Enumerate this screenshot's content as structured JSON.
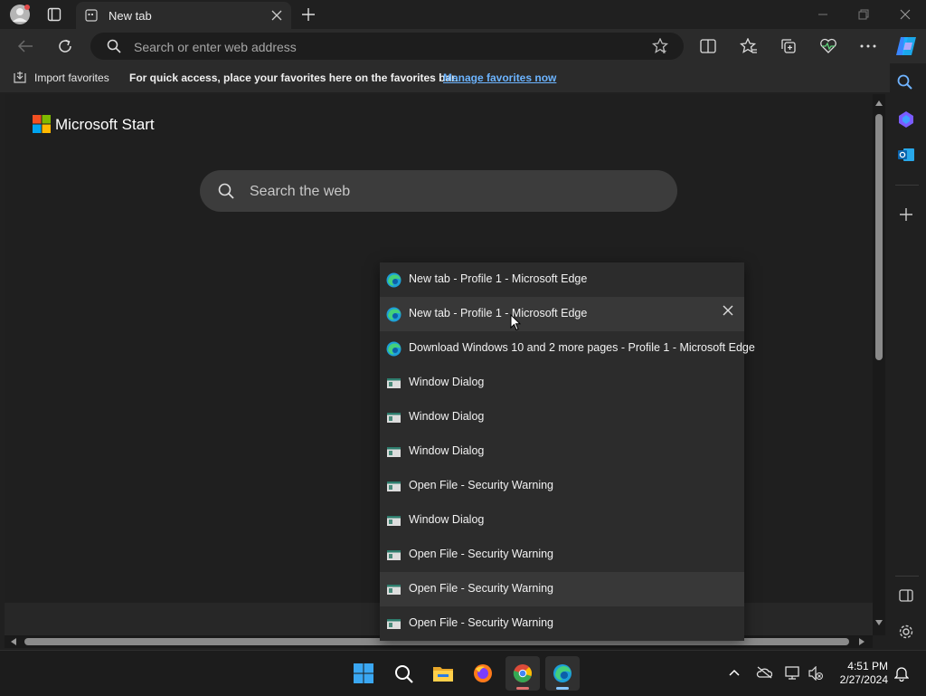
{
  "browser": {
    "tab_title": "New tab",
    "address_placeholder": "Search or enter web address"
  },
  "favorites_bar": {
    "import_label": "Import favorites",
    "hint": "For quick access, place your favorites here on the favorites bar.",
    "manage_link": "Manage favorites now"
  },
  "page": {
    "logo_text": "Microsoft Start",
    "search_placeholder": "Search the web"
  },
  "switcher": {
    "items": [
      {
        "label": "New tab - Profile 1 - Microsoft Edge",
        "icon": "edge-icon"
      },
      {
        "label": "New tab - Profile 1 - Microsoft Edge",
        "icon": "edge-icon"
      },
      {
        "label": "Download Windows 10 and 2 more pages - Profile 1 - Microsoft Edge",
        "icon": "edge-icon"
      },
      {
        "label": "Window Dialog",
        "icon": "window-icon"
      },
      {
        "label": "Window Dialog",
        "icon": "window-icon"
      },
      {
        "label": "Window Dialog",
        "icon": "window-icon"
      },
      {
        "label": "Open File - Security Warning",
        "icon": "window-icon"
      },
      {
        "label": "Window Dialog",
        "icon": "window-icon"
      },
      {
        "label": "Open File - Security Warning",
        "icon": "window-icon"
      },
      {
        "label": "Open File - Security Warning",
        "icon": "window-icon"
      },
      {
        "label": "Open File - Security Warning",
        "icon": "window-icon"
      }
    ]
  },
  "taskbar": {
    "time": "4:51 PM",
    "date": "2/27/2024"
  },
  "colors": {
    "accent": "#4ea1ff",
    "link": "#6cb4ff"
  }
}
